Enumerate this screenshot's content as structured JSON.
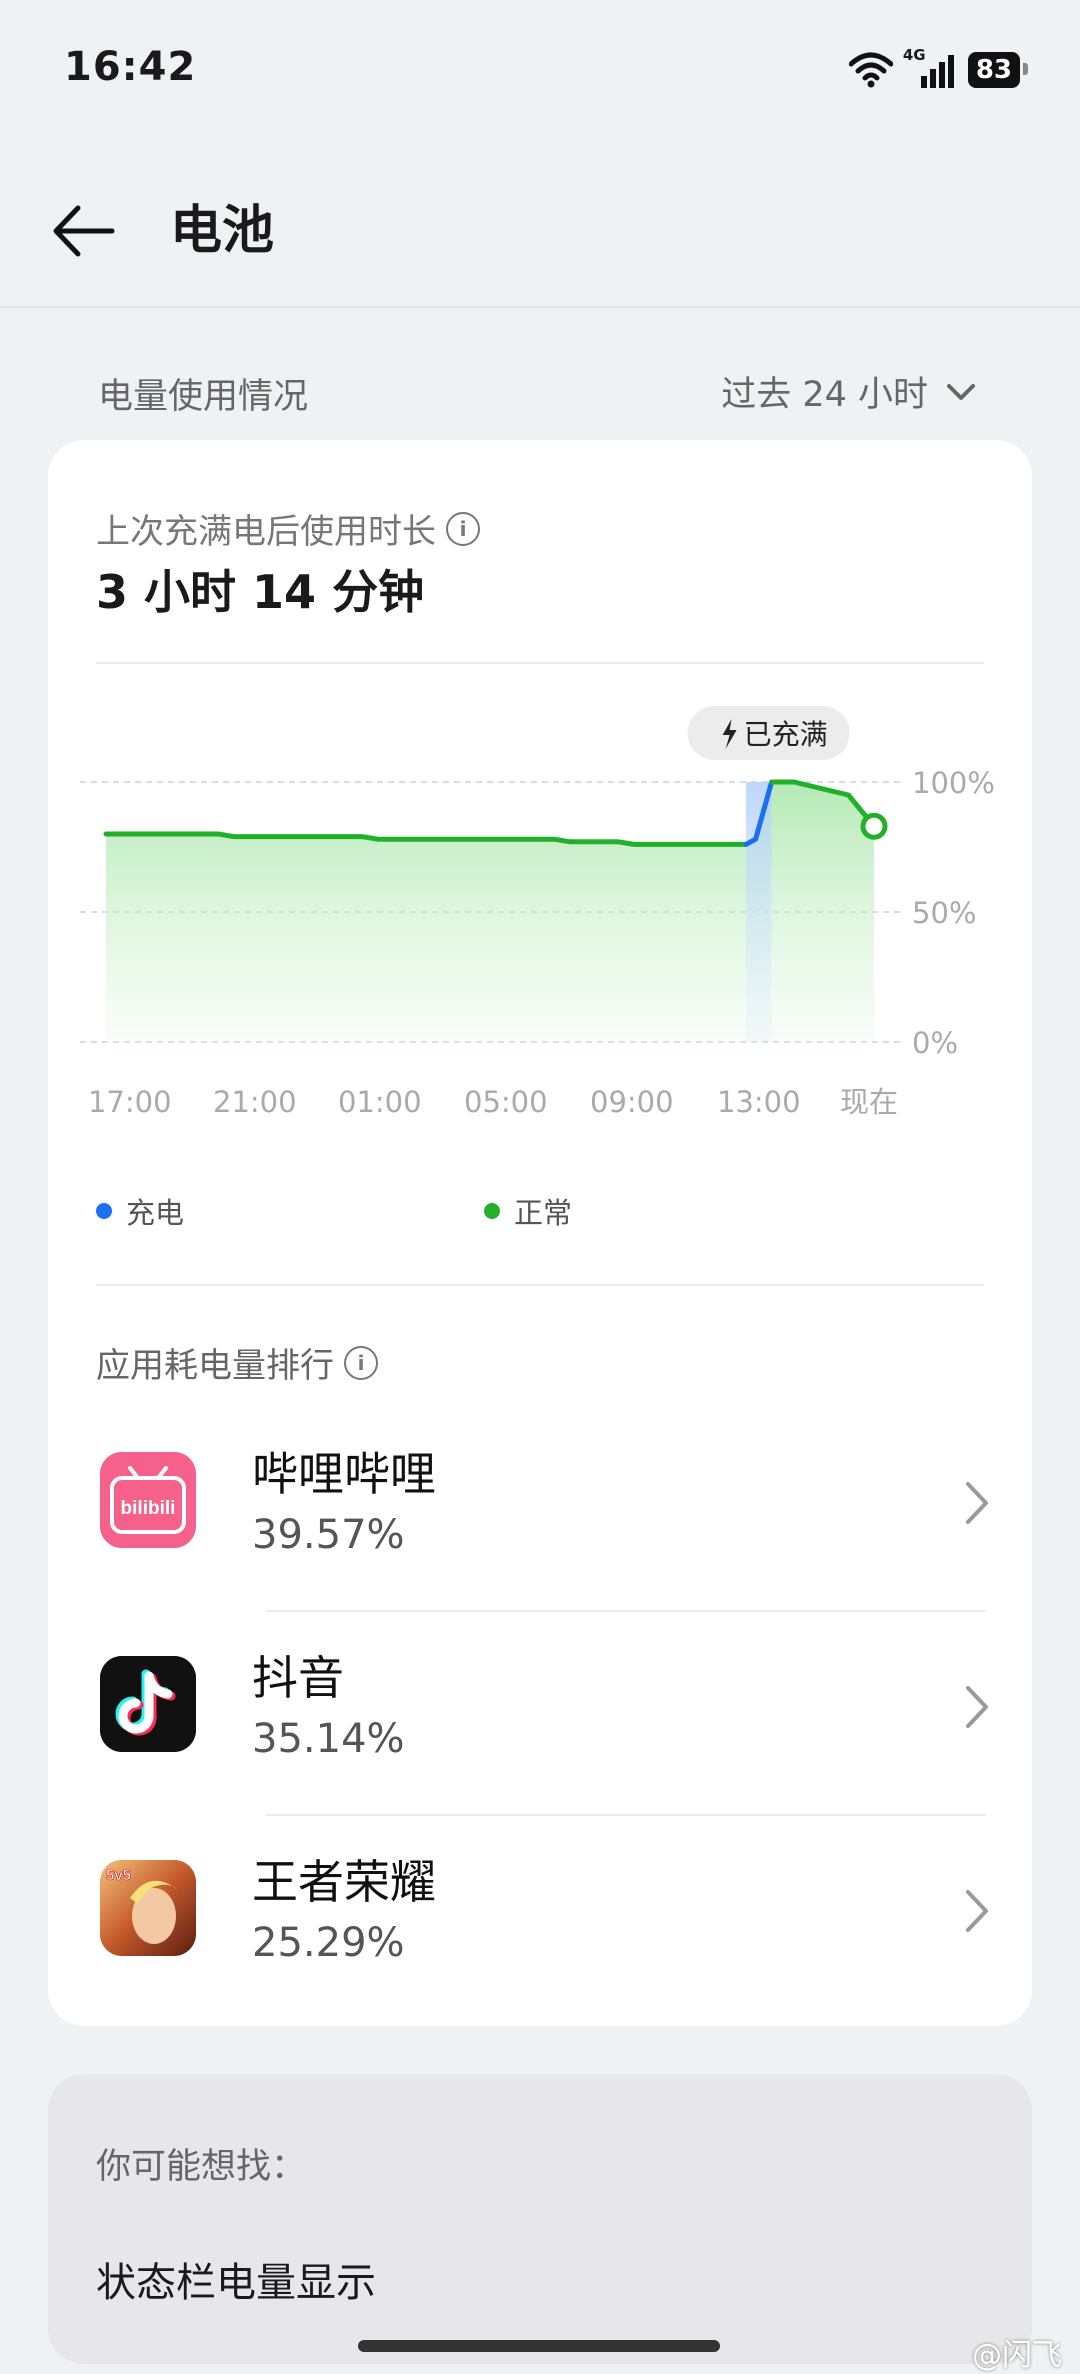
{
  "status_bar": {
    "time": "16:42",
    "network": "4G",
    "battery": "83"
  },
  "header": {
    "title": "电池"
  },
  "usage": {
    "section_label": "电量使用情况",
    "range_label": "过去 24 小时",
    "since_full_label": "上次充满电后使用时长",
    "since_full_value": "3 小时 14 分钟"
  },
  "chart_data": {
    "type": "area",
    "x_ticks": [
      "17:00",
      "21:00",
      "01:00",
      "05:00",
      "09:00",
      "13:00",
      "现在"
    ],
    "y_ticks": [
      "100%",
      "50%",
      "0%"
    ],
    "ylim": [
      0,
      100
    ],
    "x": [
      0,
      3.5,
      4,
      8,
      8.5,
      14,
      14.5,
      16,
      16.5,
      20,
      20.3,
      20.8,
      21.5,
      23.2,
      24
    ],
    "series": [
      {
        "name": "正常",
        "color": "#22b02a",
        "values": [
          80,
          80,
          79,
          79,
          78,
          78,
          77,
          77,
          76,
          76,
          78,
          100,
          100,
          95,
          83
        ]
      }
    ],
    "charging_range": [
      20,
      20.8
    ],
    "annotation": "已充满",
    "legend": [
      {
        "label": "充电",
        "color": "#1a6ff2"
      },
      {
        "label": "正常",
        "color": "#22b02a"
      }
    ]
  },
  "app_ranking": {
    "title": "应用耗电量排行",
    "apps": [
      {
        "name": "哔哩哔哩",
        "percent": "39.57%",
        "icon": "bilibili-icon",
        "icon_text": "bilibili"
      },
      {
        "name": "抖音",
        "percent": "35.14%",
        "icon": "douyin-icon"
      },
      {
        "name": "王者荣耀",
        "percent": "25.29%",
        "icon": "honor-of-kings-icon",
        "icon_text": "5v5"
      }
    ]
  },
  "suggestions": {
    "title": "你可能想找：",
    "items": [
      "状态栏电量显示"
    ]
  },
  "watermark": "@闪飞"
}
